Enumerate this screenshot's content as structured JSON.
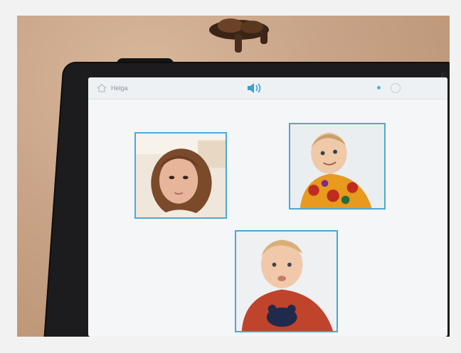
{
  "app": {
    "name": "Helga"
  },
  "icons": {
    "home": "home-icon",
    "speaker": "speaker-icon",
    "settings": "settings-icon"
  },
  "colors": {
    "tile_border": "#4aa8d8",
    "accent": "#3a9fd6"
  },
  "tiles": [
    {
      "subject": "woman-portrait"
    },
    {
      "subject": "toddler-smiling"
    },
    {
      "subject": "toddler-red-shirt"
    }
  ]
}
